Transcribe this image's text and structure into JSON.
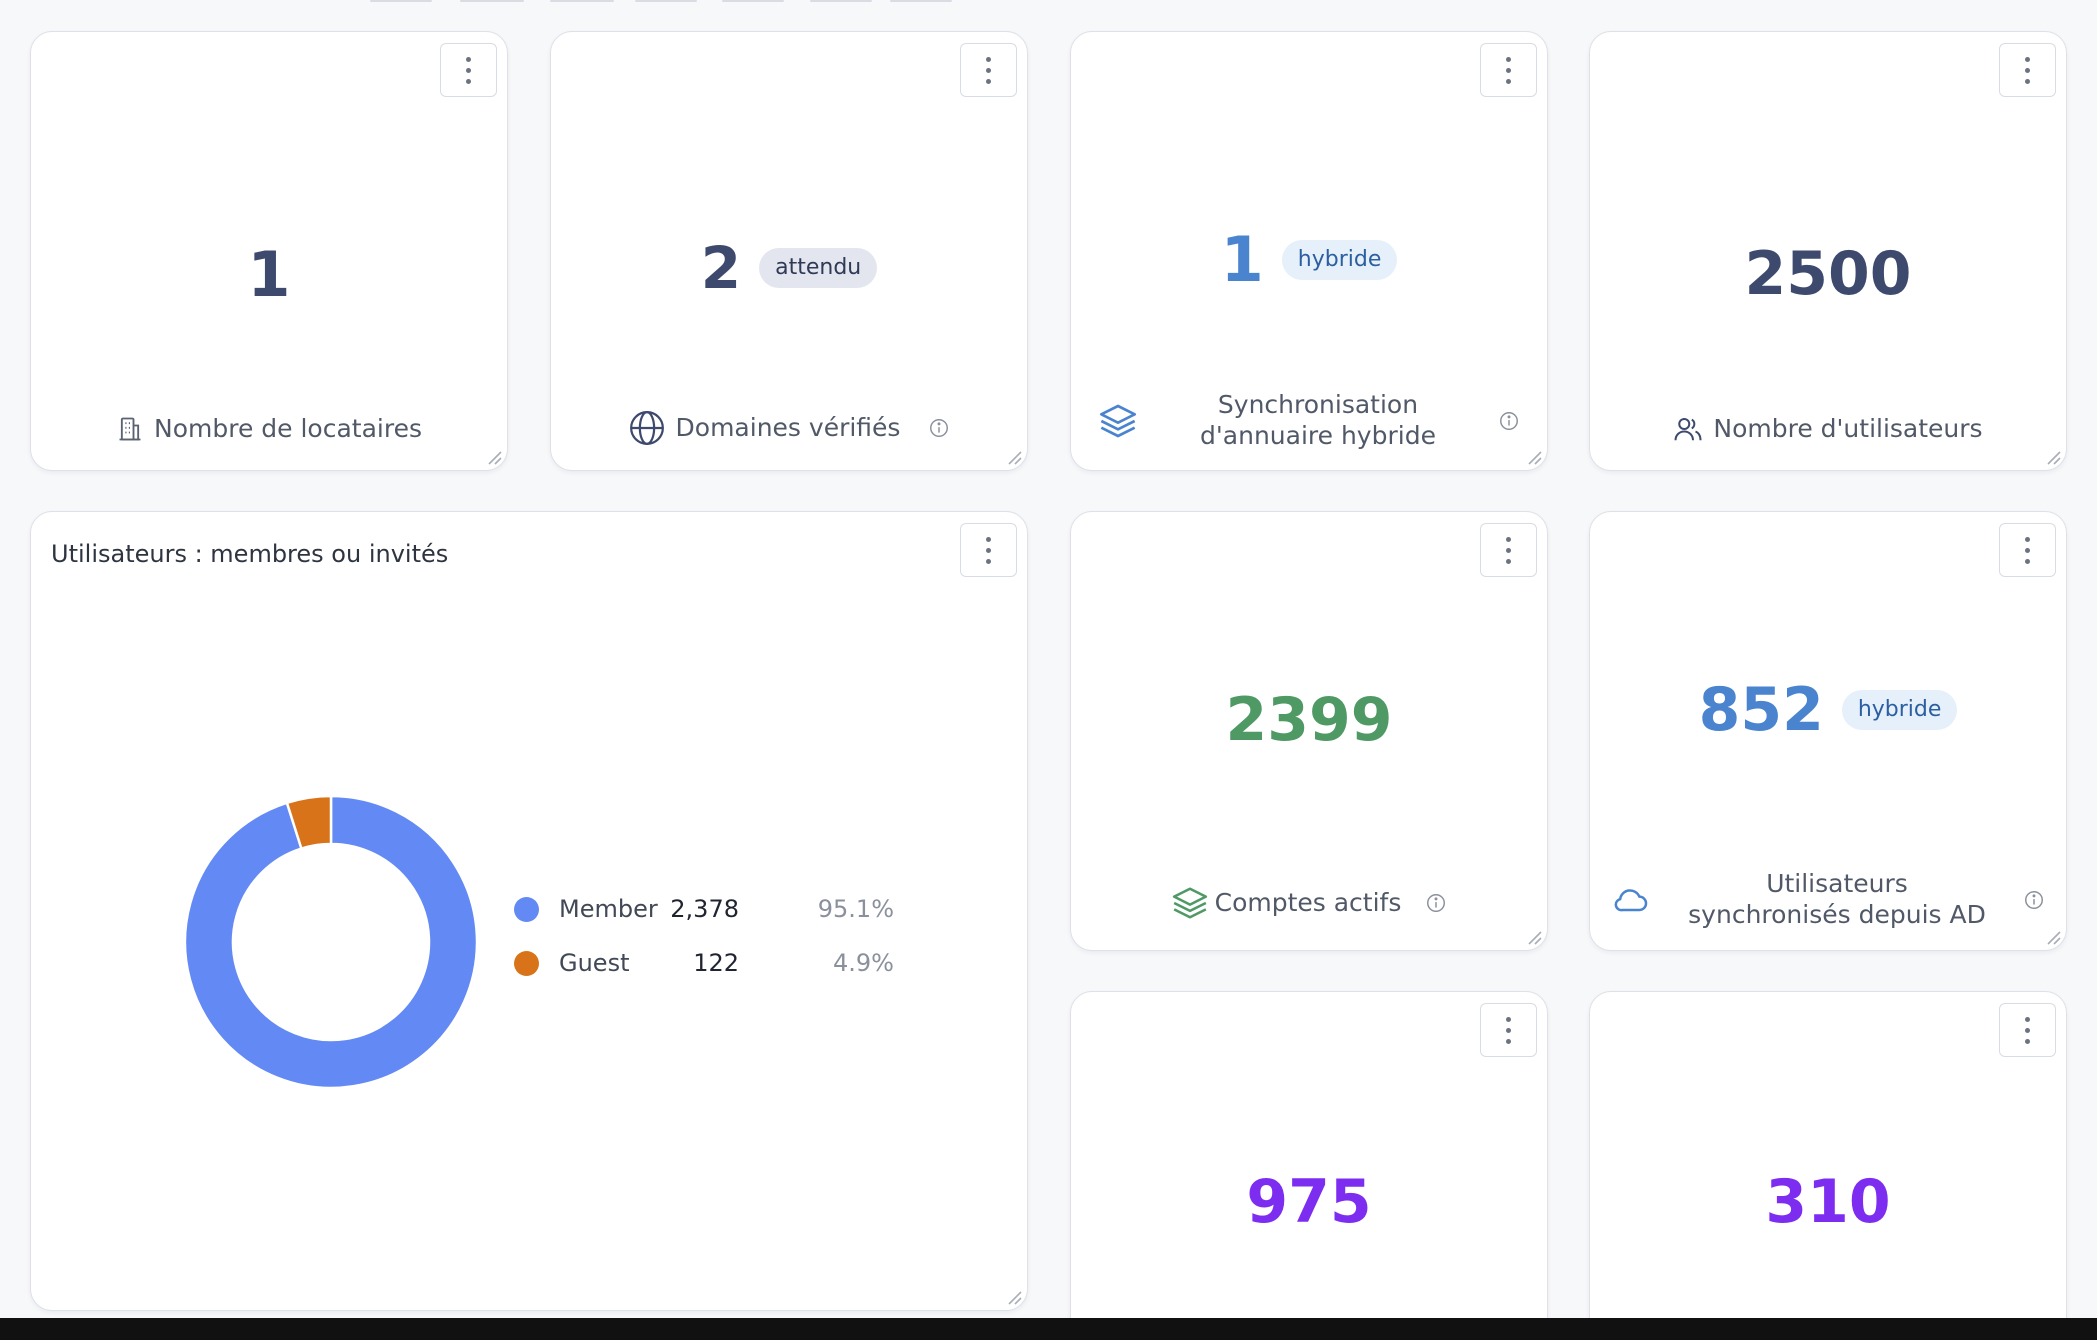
{
  "cards": {
    "tenants": {
      "value": "1",
      "label": "Nombre de locataires"
    },
    "domains": {
      "value": "2",
      "badge": "attendu",
      "label": "Domaines vérifiés"
    },
    "sync": {
      "value": "1",
      "badge": "hybride",
      "label": "Synchronisation d'annuaire hybride"
    },
    "users": {
      "value": "2500",
      "label": "Nombre d'utilisateurs"
    },
    "active": {
      "value": "2399",
      "label": "Comptes actifs"
    },
    "ad_synced": {
      "value": "852",
      "badge": "hybride",
      "label": "Utilisateurs synchronisés depuis AD"
    },
    "card_bottom_1": {
      "value": "975"
    },
    "card_bottom_2": {
      "value": "310"
    }
  },
  "chart_data": {
    "type": "pie",
    "title": "Utilisateurs : membres ou invités",
    "donut": true,
    "categories": [
      "Member",
      "Guest"
    ],
    "values": [
      2378,
      122
    ],
    "value_labels": [
      "2,378",
      "122"
    ],
    "percent_labels": [
      "95.1%",
      "4.9%"
    ],
    "colors": [
      "#6389f4",
      "#d9731a"
    ],
    "legend": "right"
  },
  "colors": {
    "slate": "#3d4a6e",
    "blue": "#4a84cf",
    "green": "#4f9965",
    "purple": "#7c2df0"
  }
}
